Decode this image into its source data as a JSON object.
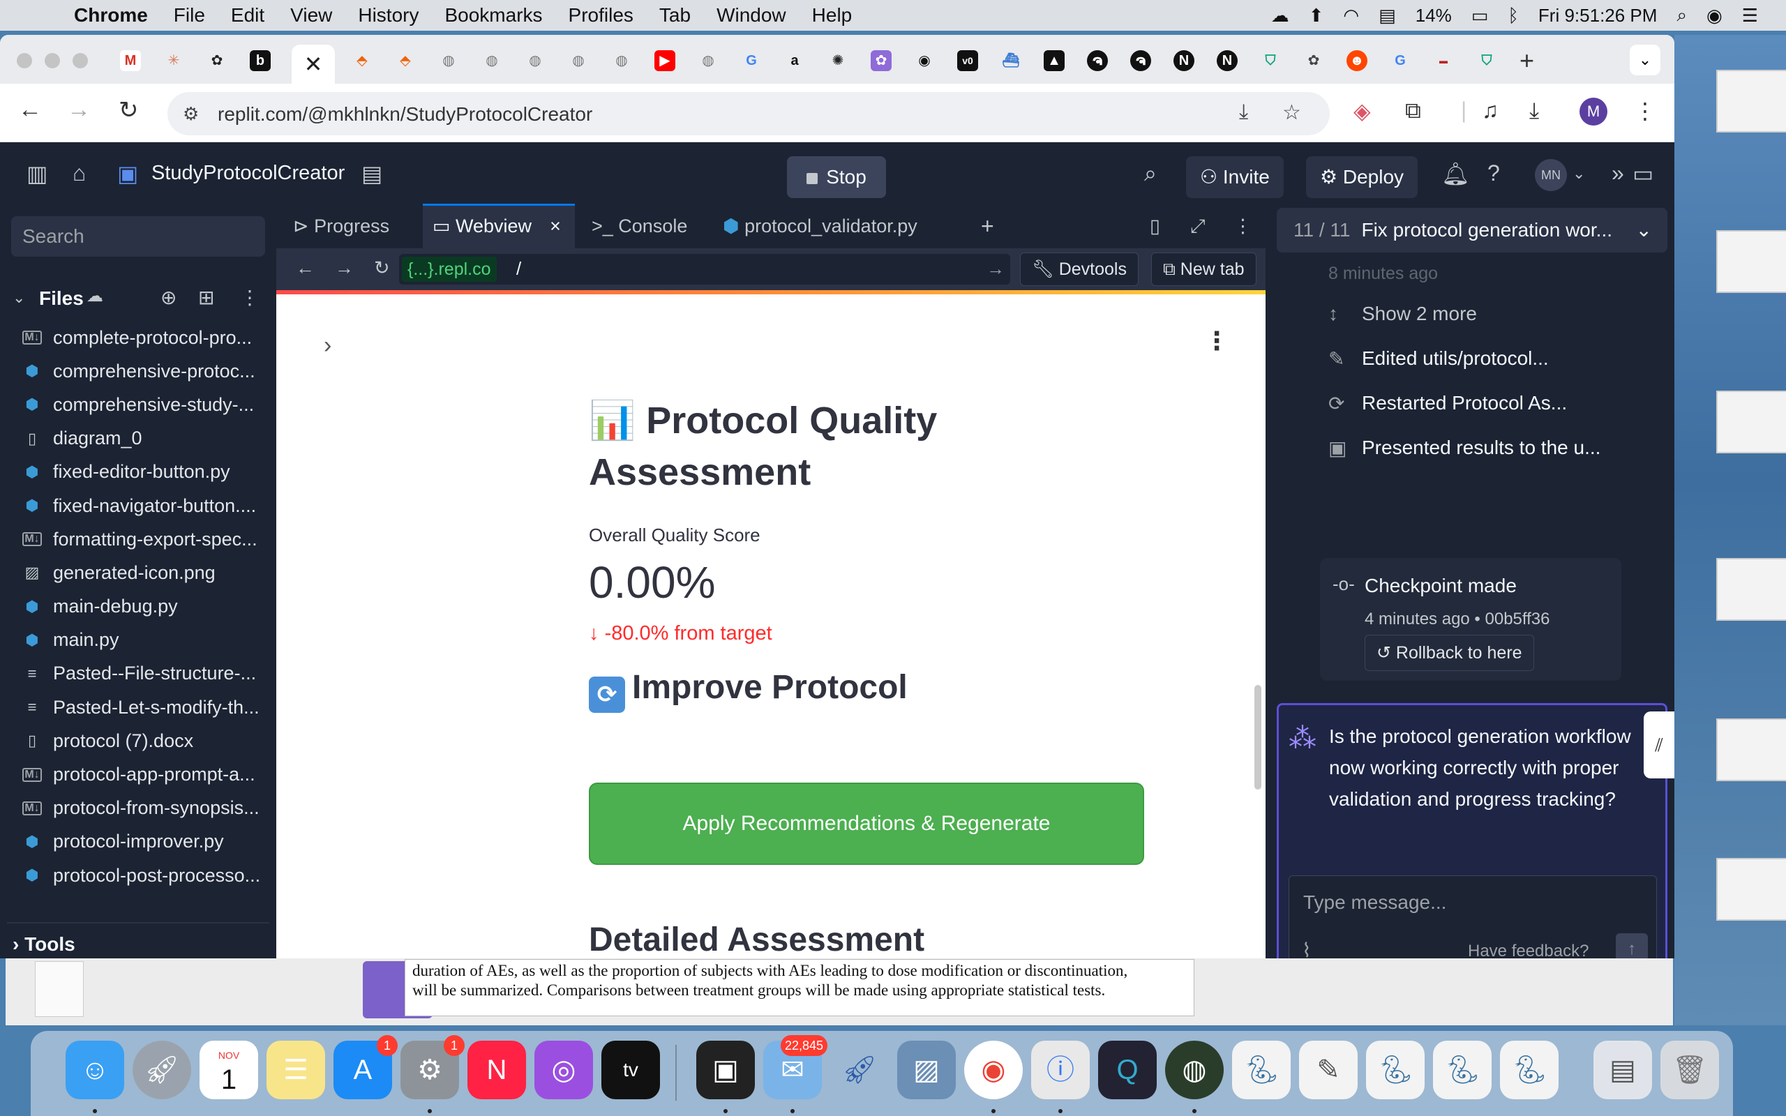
{
  "menubar": {
    "items": [
      "Chrome",
      "File",
      "Edit",
      "View",
      "History",
      "Bookmarks",
      "Profiles",
      "Tab",
      "Window",
      "Help"
    ],
    "battery": "14%",
    "clock": "Fri 9:51:26 PM"
  },
  "browser": {
    "url": "replit.com/@mkhlnkn/StudyProtocolCreator",
    "profile_initial": "M",
    "tab_close": "✕"
  },
  "replit": {
    "project_name": "StudyProtocolCreator",
    "stop_label": "Stop",
    "invite_label": "Invite",
    "deploy_label": "Deploy",
    "user_initials": "MN",
    "search_placeholder": "Search",
    "files_header": "Files",
    "tools_label": "Tools",
    "files": [
      {
        "name": "complete-protocol-pro...",
        "type": "md"
      },
      {
        "name": "comprehensive-protoc...",
        "type": "py"
      },
      {
        "name": "comprehensive-study-...",
        "type": "py"
      },
      {
        "name": "diagram_0",
        "type": "file"
      },
      {
        "name": "fixed-editor-button.py",
        "type": "py"
      },
      {
        "name": "fixed-navigator-button....",
        "type": "py"
      },
      {
        "name": "formatting-export-spec...",
        "type": "md"
      },
      {
        "name": "generated-icon.png",
        "type": "image"
      },
      {
        "name": "main-debug.py",
        "type": "py"
      },
      {
        "name": "main.py",
        "type": "py"
      },
      {
        "name": "Pasted--File-structure-...",
        "type": "text"
      },
      {
        "name": "Pasted-Let-s-modify-th...",
        "type": "text"
      },
      {
        "name": "protocol (7).docx",
        "type": "file"
      },
      {
        "name": "protocol-app-prompt-a...",
        "type": "md"
      },
      {
        "name": "protocol-from-synopsis...",
        "type": "md"
      },
      {
        "name": "protocol-improver.py",
        "type": "py"
      },
      {
        "name": "protocol-post-processo...",
        "type": "py"
      }
    ],
    "pane_tabs": {
      "progress": "Progress",
      "webview": "Webview",
      "console": "Console",
      "file": "protocol_validator.py"
    },
    "webview_bar": {
      "domain_chip": "{...}.repl.co",
      "path": "/",
      "devtools": "Devtools",
      "new_tab": "New tab"
    }
  },
  "webview": {
    "title_emoji": "📊",
    "title": "Protocol Quality Assessment",
    "metric_label": "Overall Quality Score",
    "metric_value": "0.00%",
    "metric_delta": "-80.0% from target",
    "improve_emoji": "🔄",
    "improve_heading": "Improve Protocol",
    "apply_button": "Apply Recommendations & Regenerate",
    "next_heading": "Detailed Assessment"
  },
  "agent": {
    "step_count": "11 / 11",
    "task_title": "Fix protocol generation wor...",
    "time_ago": "8 minutes ago",
    "show_more": "Show 2 more",
    "actions": [
      "Edited utils/protocol...",
      "Restarted Protocol As...",
      "Presented results to the u..."
    ],
    "checkpoint_title": "Checkpoint made",
    "checkpoint_meta": "4 minutes ago • 00b5ff36",
    "rollback_label": "Rollback to here",
    "question": "Is the protocol generation workflow now working correctly with proper validation and progress tracking?",
    "message_placeholder": "Type message...",
    "feedback_label": "Have feedback?"
  },
  "background_doc": {
    "line1": "duration of AEs, as well as the proportion of subjects with AEs leading to dose modification or discontinuation,",
    "line2": "will be summarized. Comparisons between treatment groups will be made using appropriate statistical tests."
  },
  "dock": {
    "calendar_month": "NOV",
    "calendar_day": "1",
    "appstore_badge": "1",
    "settings_badge": "1",
    "mail_badge": "22,845",
    "tv_label": "tv"
  },
  "colors": {
    "replit_bg": "#1c2333",
    "replit_panel": "#2b3245",
    "accent_blue": "#0079f2",
    "streamlit_red": "#ff2b2b",
    "apply_green": "#4caf50",
    "agent_purple": "#5b4fd6"
  }
}
